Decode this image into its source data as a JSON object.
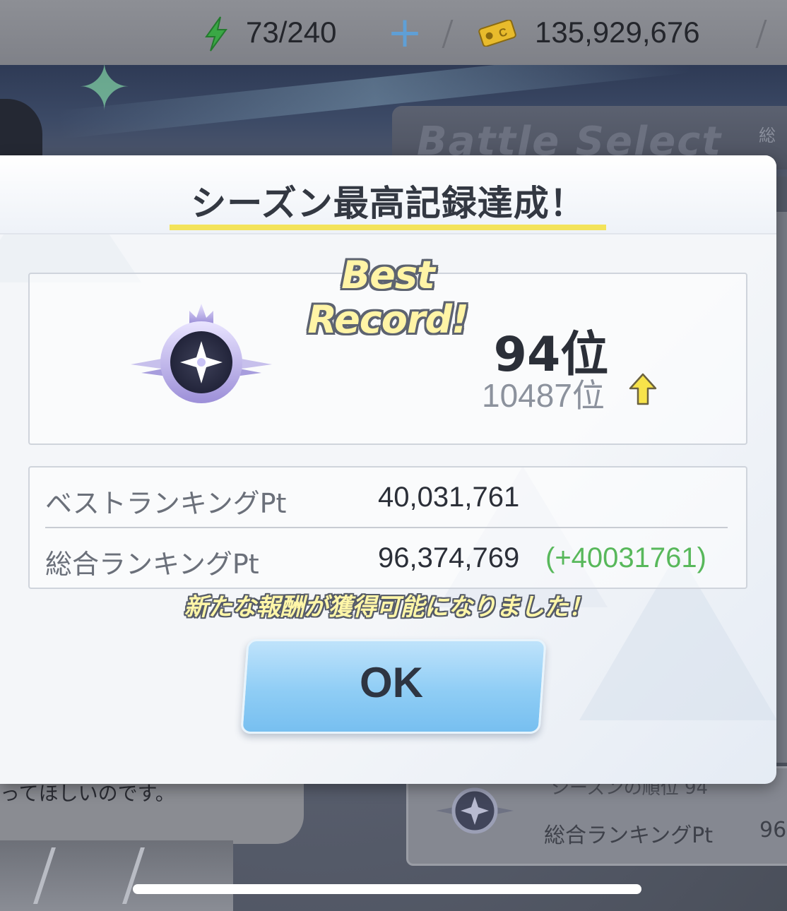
{
  "status_bar": {
    "stamina": "73/240",
    "coins": "135,929,676"
  },
  "background": {
    "header_title": "Battle Select",
    "header_sub": "総",
    "speech_text": "ってほしいのです。",
    "rank_card_top": "シーズンの順位",
    "rank_card_value_top": "94",
    "rank_card_label": "総合ランキングPt",
    "rank_card_value": "96"
  },
  "dialog": {
    "title": "シーズン最高記録達成！",
    "best_label": "Best Record!",
    "rank_new": "94位",
    "rank_prev": "10487位",
    "best_pt_label": "ベストランキングPt",
    "best_pt_value": "40,031,761",
    "total_pt_label": "総合ランキングPt",
    "total_pt_value": "96,374,769",
    "total_pt_delta": "(+40031761)",
    "reward_message": "新たな報酬が獲得可能になりました！",
    "ok_label": "OK"
  },
  "colors": {
    "title_underline": "#f3e35a",
    "delta_green": "#58b85b",
    "ok_button": "#8fcdf5",
    "stamina_green": "#3aa845"
  },
  "icons": [
    "lightning-icon",
    "plus-icon",
    "coin-ticket-icon",
    "rank-emblem-icon",
    "rank-up-arrow-icon"
  ]
}
